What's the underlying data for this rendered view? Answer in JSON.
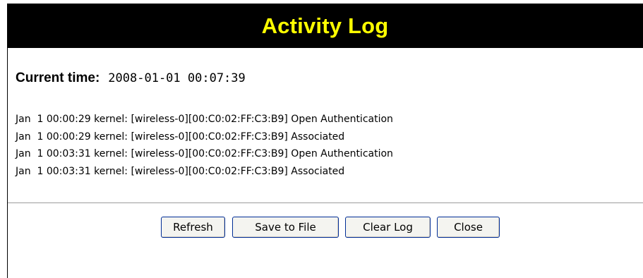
{
  "header": {
    "title": "Activity Log"
  },
  "current_time": {
    "label": "Current time:",
    "value": "2008-01-01 00:07:39"
  },
  "log": {
    "lines": [
      "Jan  1 00:00:29 kernel: [wireless-0][00:C0:02:FF:C3:B9] Open Authentication",
      "Jan  1 00:00:29 kernel: [wireless-0][00:C0:02:FF:C3:B9] Associated",
      "Jan  1 00:03:31 kernel: [wireless-0][00:C0:02:FF:C3:B9] Open Authentication",
      "Jan  1 00:03:31 kernel: [wireless-0][00:C0:02:FF:C3:B9] Associated"
    ]
  },
  "buttons": {
    "refresh": "Refresh",
    "save_to_file": "Save to File",
    "clear_log": "Clear Log",
    "close": "Close"
  },
  "colors": {
    "title_bar_background": "#000000",
    "title_text": "#ffff00",
    "button_border": "#002d96",
    "button_background": "#f4f4f0",
    "divider": "#9c9c9c"
  }
}
